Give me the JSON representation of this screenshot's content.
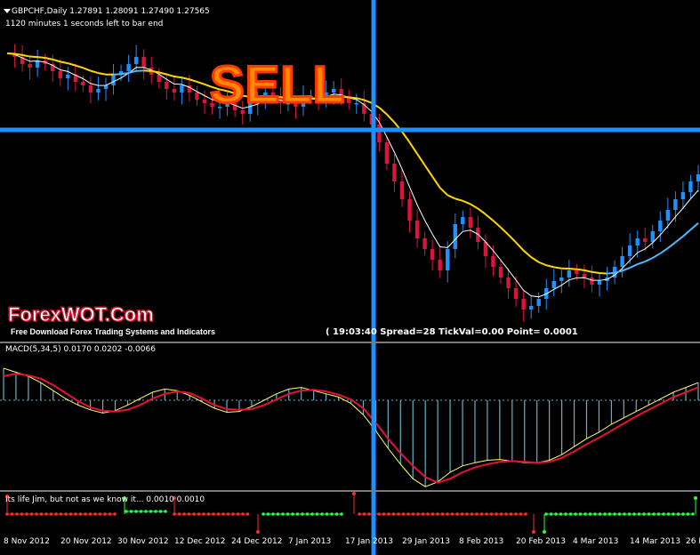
{
  "header": {
    "symbol_line": "GBPCHF,Daily  1.27891 1.28091 1.27490 1.27565",
    "timer_line": "1120 minutes 1 seconds left to bar end"
  },
  "overlay": {
    "sell_label": "SELL",
    "brand": "ForexWOT.Com",
    "brand_sub": "Free Download Forex Trading Systems and Indicators",
    "status": "( 19:03:40     Spread=28  TickVal=0.00  Point= 0.0001"
  },
  "macd": {
    "label": "MACD(5,34,5) 0.0170 0.0202 -0.0066"
  },
  "indicator": {
    "label": "Its life Jim, but not as we know it...  0.0010 0.0010"
  },
  "colors": {
    "bull": "#1e90ff",
    "bear": "#dc143c",
    "ema_slow": "#ffd700",
    "ema_fast": "#ffffff",
    "ema_slow_up": "#4fb8ff",
    "signal_line": "#1e90ff",
    "macd_red": "#e8103a",
    "macd_yellow": "#ffff66",
    "hist": "#5fb3c4",
    "dots_red": "#ff2a2a",
    "dots_green": "#22ff44"
  },
  "chart_data": {
    "type": "candlestick",
    "x_labels": [
      "8 Nov 2012",
      "20 Nov 2012",
      "30 Nov 2012",
      "12 Dec 2012",
      "24 Dec 2012",
      "7 Jan 2013",
      "17 Jan 2013",
      "29 Jan 2013",
      "8 Feb 2013",
      "20 Feb 2013",
      "4 Mar 2013",
      "14 Mar 2013",
      "26 M"
    ],
    "close_series": [
      1.29,
      1.289,
      1.287,
      1.286,
      1.288,
      1.287,
      1.285,
      1.283,
      1.284,
      1.282,
      1.281,
      1.279,
      1.28,
      1.281,
      1.284,
      1.285,
      1.287,
      1.289,
      1.286,
      1.284,
      1.282,
      1.28,
      1.279,
      1.281,
      1.279,
      1.277,
      1.276,
      1.275,
      1.275,
      1.276,
      1.274,
      1.273,
      1.276,
      1.277,
      1.279,
      1.278,
      1.276,
      1.276,
      1.275,
      1.278,
      1.278,
      1.277,
      1.279,
      1.28,
      1.278,
      1.276,
      1.276,
      1.273,
      1.27,
      1.265,
      1.259,
      1.254,
      1.249,
      1.243,
      1.238,
      1.235,
      1.232,
      1.229,
      1.235,
      1.242,
      1.244,
      1.241,
      1.237,
      1.233,
      1.23,
      1.227,
      1.224,
      1.221,
      1.218,
      1.219,
      1.221,
      1.224,
      1.226,
      1.227,
      1.229,
      1.228,
      1.227,
      1.225,
      1.226,
      1.227,
      1.23,
      1.233,
      1.236,
      1.238,
      1.237,
      1.24,
      1.243,
      1.246,
      1.249,
      1.251,
      1.254,
      1.256
    ],
    "macd_series": [
      0.004,
      0.0035,
      0.003,
      0.0022,
      0.0012,
      0.0002,
      -0.0006,
      -0.0012,
      -0.0016,
      -0.0013,
      -0.0006,
      0.0002,
      0.001,
      0.0014,
      0.0012,
      0.0006,
      -0.0002,
      -0.001,
      -0.0015,
      -0.0014,
      -0.0008,
      0.0,
      0.0008,
      0.0014,
      0.0016,
      0.0012,
      0.0008,
      0.0004,
      -0.0004,
      -0.0018,
      -0.0038,
      -0.006,
      -0.008,
      -0.0098,
      -0.0108,
      -0.0102,
      -0.009,
      -0.0082,
      -0.0078,
      -0.0075,
      -0.0074,
      -0.0076,
      -0.0078,
      -0.0078,
      -0.0075,
      -0.0068,
      -0.0058,
      -0.0048,
      -0.004,
      -0.003,
      -0.0022,
      -0.0014,
      -0.0006,
      0.0002,
      0.001,
      0.0016,
      0.0022
    ],
    "signal_series": [
      0.003,
      0.0033,
      0.0031,
      0.0027,
      0.0019,
      0.0009,
      -0.0001,
      -0.0009,
      -0.0013,
      -0.0014,
      -0.0012,
      -0.0006,
      0.0002,
      0.0008,
      0.0011,
      0.0009,
      0.0002,
      -0.0006,
      -0.0011,
      -0.0012,
      -0.0011,
      -0.0006,
      0.0001,
      0.0008,
      0.0012,
      0.0013,
      0.0011,
      0.0007,
      0.0001,
      -0.001,
      -0.0028,
      -0.0048,
      -0.0066,
      -0.0082,
      -0.0096,
      -0.0103,
      -0.0098,
      -0.009,
      -0.0084,
      -0.008,
      -0.0077,
      -0.0076,
      -0.0077,
      -0.0078,
      -0.0077,
      -0.0072,
      -0.0064,
      -0.0055,
      -0.0047,
      -0.0038,
      -0.0029,
      -0.002,
      -0.0012,
      -0.0004,
      0.0004,
      0.001,
      0.0016
    ]
  }
}
